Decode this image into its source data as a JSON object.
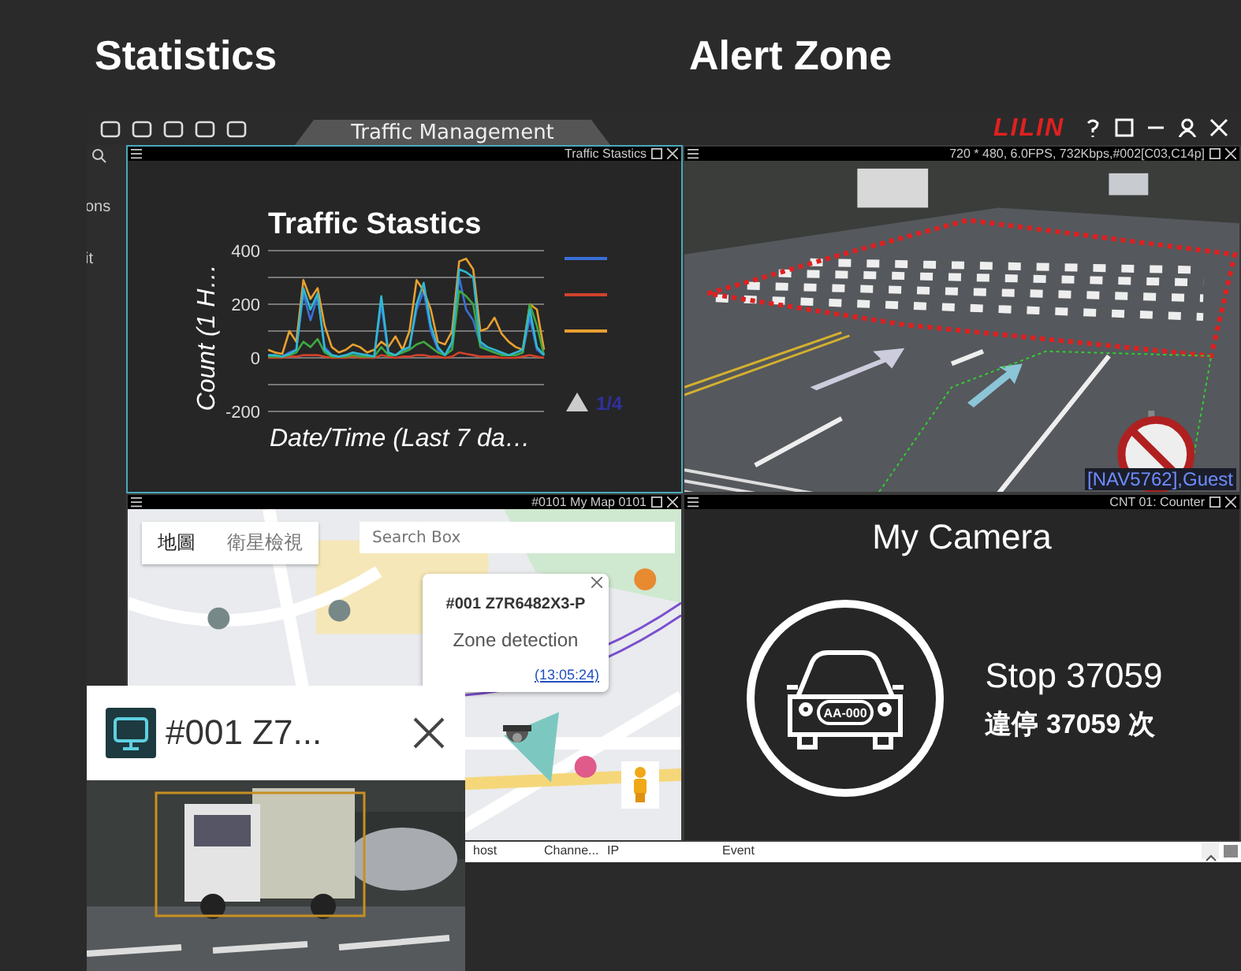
{
  "headings": [
    {
      "text": "Statistics"
    },
    {
      "text": "Alert Zone"
    }
  ],
  "toolbar": {
    "tab": {
      "label": "Traffic Management",
      "selected": true
    }
  },
  "sidebar": {
    "items": [
      "ons",
      "it"
    ]
  },
  "panels": [
    {
      "kind": "chart",
      "title": "Traffic Stastics",
      "selected": true,
      "legend_page": "1/4",
      "chart_data": {
        "type": "line",
        "title": "Traffic Stastics",
        "xlabel": "Date/Time (Last 7 da…",
        "ylabel": "Count (1 H…",
        "ylim": [
          -200,
          400
        ],
        "yticks": [
          -200,
          0,
          200,
          400
        ],
        "series": [
          {
            "color": "#3a6fd8",
            "values": [
              10,
              5,
              5,
              20,
              30,
              240,
              140,
              230,
              40,
              10,
              5,
              10,
              20,
              10,
              10,
              5,
              200,
              10,
              10,
              20,
              40,
              180,
              250,
              100,
              30,
              10,
              50,
              300,
              180,
              140,
              50,
              30,
              20,
              15,
              10,
              10,
              20,
              150,
              30,
              10
            ]
          },
          {
            "color": "#d0422b",
            "values": [
              0,
              0,
              0,
              5,
              5,
              10,
              10,
              10,
              5,
              0,
              0,
              0,
              5,
              0,
              0,
              0,
              10,
              5,
              0,
              5,
              5,
              10,
              10,
              5,
              5,
              0,
              5,
              20,
              15,
              10,
              5,
              5,
              5,
              0,
              0,
              0,
              5,
              10,
              5,
              0
            ]
          },
          {
            "color": "#e8a030",
            "values": [
              30,
              20,
              15,
              100,
              60,
              290,
              220,
              260,
              120,
              40,
              20,
              30,
              50,
              40,
              20,
              30,
              60,
              40,
              80,
              30,
              100,
              290,
              250,
              180,
              60,
              50,
              100,
              360,
              370,
              330,
              100,
              110,
              150,
              90,
              60,
              40,
              30,
              200,
              180,
              30
            ]
          },
          {
            "color": "#3fa83f",
            "values": [
              5,
              5,
              5,
              10,
              20,
              60,
              40,
              70,
              20,
              5,
              5,
              5,
              10,
              5,
              5,
              5,
              40,
              10,
              10,
              20,
              30,
              50,
              60,
              40,
              20,
              10,
              30,
              250,
              230,
              200,
              40,
              30,
              20,
              10,
              10,
              10,
              20,
              200,
              120,
              10
            ]
          },
          {
            "color": "#30b8d0",
            "values": [
              10,
              10,
              5,
              15,
              30,
              260,
              180,
              240,
              30,
              10,
              5,
              10,
              20,
              15,
              10,
              5,
              230,
              20,
              10,
              30,
              40,
              200,
              280,
              120,
              40,
              10,
              60,
              330,
              320,
              300,
              60,
              40,
              30,
              20,
              10,
              20,
              30,
              180,
              40,
              10
            ]
          }
        ]
      }
    },
    {
      "kind": "video",
      "title": "720 * 480, 6.0FPS, 732Kbps,#002[C03,C14p]",
      "selected": false,
      "logo": "LILIN",
      "user": "[NAV5762],Guest"
    },
    {
      "kind": "map",
      "title": "#0101 My Map 0101",
      "selected": false,
      "map_types": [
        {
          "label": "地圖",
          "selected": true
        },
        {
          "label": "衛星檢視",
          "selected": false
        }
      ],
      "search": {
        "placeholder": "Search Box"
      },
      "popup": {
        "camera": "#001 Z7R6482X3-P",
        "event": "Zone detection",
        "time": "(13:05:24)"
      }
    },
    {
      "kind": "counter",
      "title": "CNT 01: Counter",
      "selected": false,
      "camera": "My Camera",
      "plate": "AA-000",
      "lines": [
        "Stop 37059",
        "違停 37059 次"
      ]
    }
  ],
  "event_log": {
    "columns": [
      "host",
      "Channe...",
      "IP",
      "Event"
    ]
  },
  "popup": {
    "title": "#001 Z7..."
  }
}
